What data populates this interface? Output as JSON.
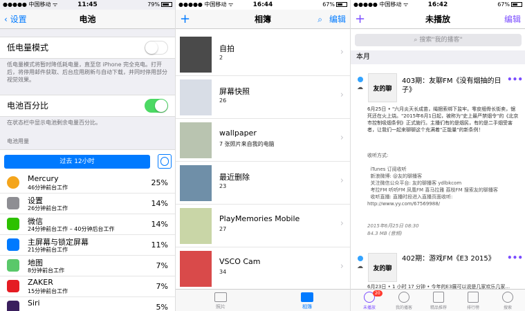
{
  "panel_battery": {
    "status": {
      "carrier": "●●●●● 中国移动 ᯤ",
      "time": "11:45",
      "battery": "79%"
    },
    "nav": {
      "back": "设置",
      "title": "电池"
    },
    "low_power": {
      "label": "低电量模式",
      "note": "低电量模式将暂时降低耗电量，直至您 iPhone 完全充电。打开后，将停用邮件获取、后台应用刷新与自动下载，并同时停用部分视觉效果。"
    },
    "battery_pct": {
      "label": "电池百分比",
      "note": "在状态栏中显示电池剩余电量百分比。"
    },
    "usage_header": "电池用量",
    "segment_label": "过去 12小时",
    "apps": [
      {
        "name": "Mercury",
        "sub": "46分钟前台工作",
        "pct": "25%",
        "color": "#f4a51c"
      },
      {
        "name": "设置",
        "sub": "26分钟前台工作",
        "pct": "14%",
        "color": "#8e8e93"
      },
      {
        "name": "微信",
        "sub": "24分钟前台工作 – 40分钟后台工作",
        "pct": "14%",
        "color": "#2dc100"
      },
      {
        "name": "主屏幕与锁定屏幕",
        "sub": "21分钟前台工作",
        "pct": "11%",
        "color": "#007aff"
      },
      {
        "name": "地图",
        "sub": "8分钟前台工作",
        "pct": "7%",
        "color": "#5ac86a"
      },
      {
        "name": "ZAKER",
        "sub": "15分钟前台工作",
        "pct": "7%",
        "color": "#e51c23"
      },
      {
        "name": "Siri",
        "sub": "",
        "pct": "5%",
        "color": "#3a1f5d"
      }
    ]
  },
  "panel_albums": {
    "status": {
      "carrier": "●●●●● 中国移动 ᯤ",
      "time": "16:44",
      "battery": "67%"
    },
    "nav": {
      "add": "+",
      "title": "相簿",
      "edit": "编辑"
    },
    "albums": [
      {
        "name": "自拍",
        "count": "2",
        "color": "#4a4a4a"
      },
      {
        "name": "屏幕快照",
        "count": "26",
        "color": "#d8dde6"
      },
      {
        "name": "wallpaper",
        "count": "7 张照片来自我的电脑",
        "color": "#b9c4b0"
      },
      {
        "name": "最近删除",
        "count": "23",
        "color": "#6f8fa8"
      },
      {
        "name": "PlayMemories Mobile",
        "count": "27",
        "color": "#c9d6a7"
      },
      {
        "name": "VSCO Cam",
        "count": "34",
        "color": "#d94a4a"
      }
    ],
    "tabs": [
      {
        "label": "照片"
      },
      {
        "label": "相簿"
      }
    ]
  },
  "panel_podcasts": {
    "status": {
      "carrier": "●●●●● 中国移动 ᯤ",
      "time": "16:42",
      "battery": "67%"
    },
    "nav": {
      "add": "+",
      "title": "未播放",
      "edit": "编辑"
    },
    "search_placeholder": "搜索\"我的播客\"",
    "section_title": "本月",
    "episodes": [
      {
        "title": "403期：友聊FM《没有烟抽的日子》",
        "art_text": "友的聊",
        "summary": "6月25日 • \"六月炎天长成苗，绳捆索绑下监牢。零皮细骨长街卖，锯死还在火上烧。\"2015年6月1日起，被称为\"史上最严禁烟令\"的《北京市控制吸烟条例》正式施行。主播们有的是烟民，有的是二手烟受害者，让我们一起来聊聊这个充满着\"正能量\"的新条例！",
        "details": "收听方式:\n\n  iTunes 订阅收听\n  新浪微博: @友的聊播客\n  关注微信公众平台: 友的聊播客 ydlbkcom\n  考拉FM 听听FM 凤凰FM 喜马拉雅 荔枝FM 搜索友的聊播客\n  收听直播: 直播时段进入直播页面收听: http://www.yy.com/67569988/",
        "date": "2015年6月25日 08:30",
        "size": "84.3 MB (音频)"
      },
      {
        "title": "402期：游戏FM《E3 2015》",
        "art_text": "友的聊",
        "summary": "6月23日 • 1 小时 17 分钟 • 今年的E3展可以说是几家欢乐几家..."
      }
    ],
    "tabs": [
      {
        "label": "未播放",
        "badge": "20"
      },
      {
        "label": "我的播客"
      },
      {
        "label": "精品推荐"
      },
      {
        "label": "排行榜"
      },
      {
        "label": "搜索"
      }
    ]
  }
}
